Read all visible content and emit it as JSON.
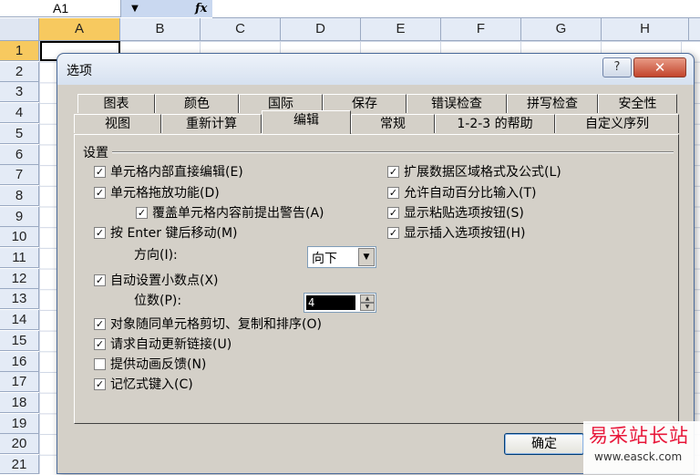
{
  "sheet": {
    "name_box": "A1",
    "name_dropdown_icon": "triangle-down",
    "fx_label": "fx",
    "columns": [
      "A",
      "B",
      "C",
      "D",
      "E",
      "F",
      "G",
      "H"
    ],
    "rows": [
      "1",
      "2",
      "3",
      "4",
      "5",
      "6",
      "7",
      "8",
      "9",
      "10",
      "11",
      "12",
      "13",
      "14",
      "15",
      "16",
      "17",
      "18",
      "19",
      "20",
      "21"
    ]
  },
  "dialog": {
    "title": "选项",
    "help_label": "?",
    "close_label": "✕",
    "tabs_back": [
      "图表",
      "颜色",
      "国际",
      "保存",
      "错误检查",
      "拼写检查",
      "安全性"
    ],
    "tabs_front": [
      "视图",
      "重新计算",
      "编辑",
      "常规",
      "1-2-3 的帮助",
      "自定义序列"
    ],
    "active_tab": "编辑",
    "group_label": "设置",
    "left_options": {
      "edit_in_cell": {
        "label": "单元格内部直接编辑(E)",
        "checked": true
      },
      "drag_drop": {
        "label": "单元格拖放功能(D)",
        "checked": true
      },
      "alert_overwrite": {
        "label": "覆盖单元格内容前提出警告(A)",
        "checked": true
      },
      "move_after_enter": {
        "label": "按 Enter 键后移动(M)",
        "checked": true
      },
      "fixed_decimal": {
        "label": "自动设置小数点(X)",
        "checked": true
      },
      "cut_copy_sort": {
        "label": "对象随同单元格剪切、复制和排序(O)",
        "checked": true
      },
      "ask_update_links": {
        "label": "请求自动更新链接(U)",
        "checked": true
      },
      "animation_feedback": {
        "label": "提供动画反馈(N)",
        "checked": false
      },
      "autocomplete": {
        "label": "记忆式键入(C)",
        "checked": true
      }
    },
    "right_options": {
      "extend_formats": {
        "label": "扩展数据区域格式及公式(L)",
        "checked": true
      },
      "auto_percent": {
        "label": "允许自动百分比输入(T)",
        "checked": true
      },
      "paste_options": {
        "label": "显示粘贴选项按钮(S)",
        "checked": true
      },
      "insert_options": {
        "label": "显示插入选项按钮(H)",
        "checked": true
      }
    },
    "direction_label": "方向(I):",
    "direction_value": "向下",
    "places_label": "位数(P):",
    "places_value": "4",
    "ok_label": "确定"
  },
  "watermark": {
    "title": "易采站长站",
    "url": "www.easck.com"
  },
  "check_mark": "✓"
}
